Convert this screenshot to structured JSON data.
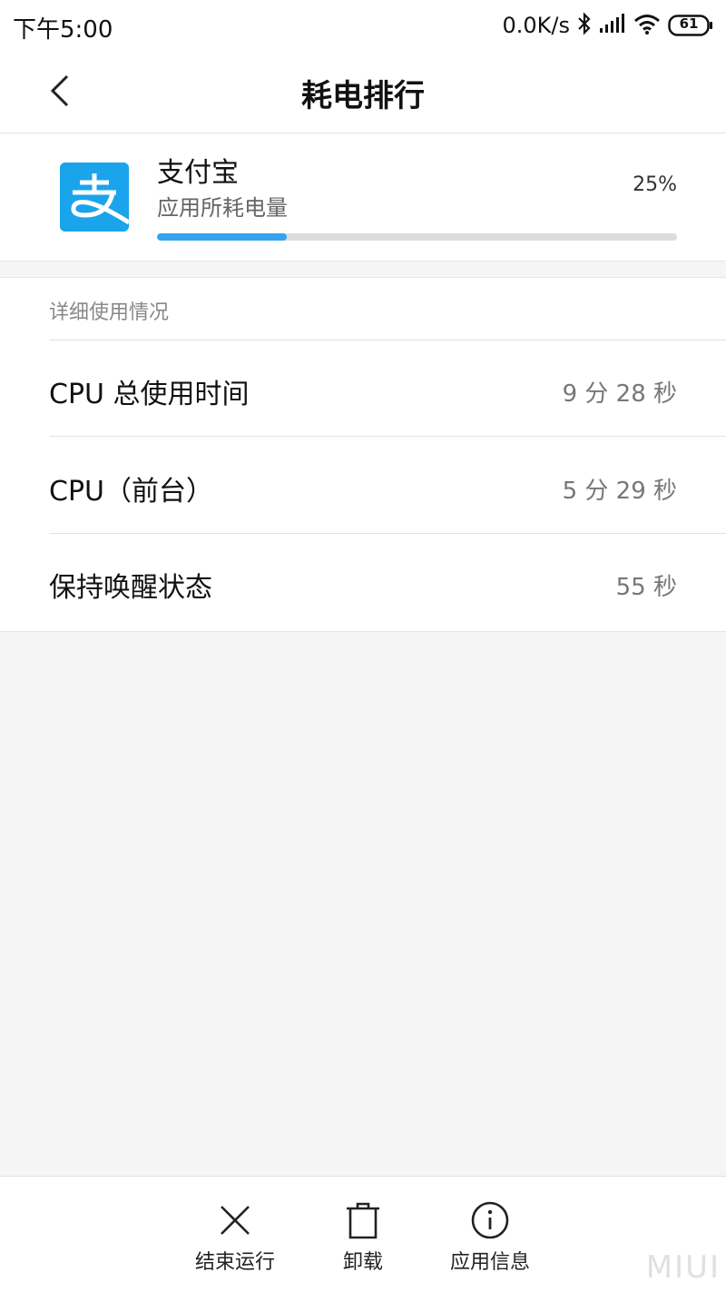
{
  "status_bar": {
    "time": "下午5:00",
    "network_speed": "0.0K/s",
    "battery_level": "61",
    "icons": [
      "bluetooth-icon",
      "signal-icon",
      "wifi-icon",
      "battery-icon"
    ]
  },
  "header": {
    "title": "耗电排行",
    "back_icon": "chevron-left-icon"
  },
  "app": {
    "name": "支付宝",
    "subtitle": "应用所耗电量",
    "percent_text": "25%",
    "percent_value": 25,
    "icon_color": "#1aa4ec",
    "bar_color": "#33a3ef"
  },
  "detail": {
    "header": "详细使用情况",
    "rows": [
      {
        "label": "CPU 总使用时间",
        "value": "9 分 28 秒"
      },
      {
        "label": "CPU（前台）",
        "value": "5 分 29 秒"
      },
      {
        "label": "保持唤醒状态",
        "value": "55 秒"
      }
    ]
  },
  "actions": [
    {
      "label": "结束运行",
      "icon": "close-icon"
    },
    {
      "label": "卸载",
      "icon": "trash-icon"
    },
    {
      "label": "应用信息",
      "icon": "info-icon"
    }
  ],
  "watermark": "MIUI"
}
